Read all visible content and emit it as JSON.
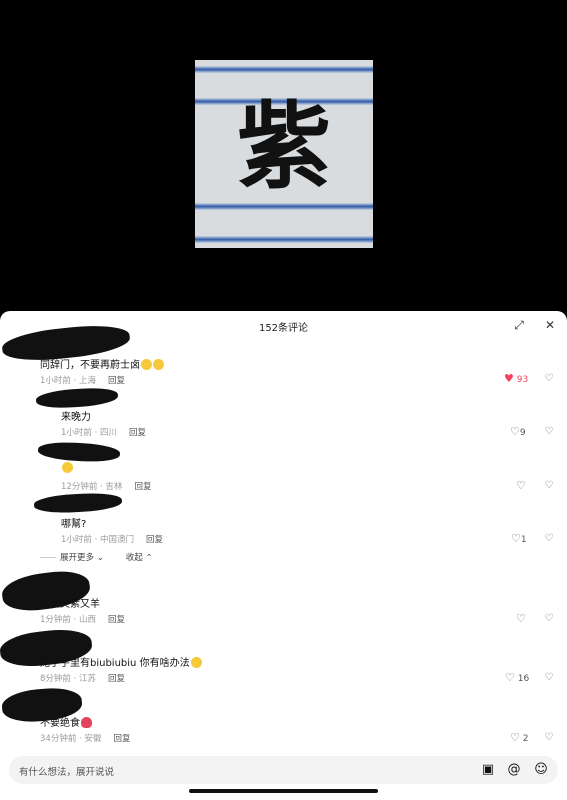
{
  "video": {
    "character": "紫"
  },
  "sheet": {
    "title": "152条评论",
    "expand_icon": "expand-icon",
    "close_icon": "close-icon"
  },
  "comments": [
    {
      "text": "同辞门，不要再蔚士卤",
      "emoji_count": 2,
      "time": "1小时前 · 上海",
      "reply": "回复",
      "likes": "93",
      "liked": true
    },
    {
      "text": "来晚力",
      "time": "1小时前 · 四川",
      "reply": "回复",
      "likes": "9"
    },
    {
      "text": "",
      "emoji_count": 1,
      "time": "12分钟前 · 吉林",
      "reply": "回复",
      "likes": ""
    },
    {
      "text": "哪幫?",
      "time": "1小时前 · 中国澳门",
      "reply": "回复",
      "likes": "1"
    },
    {
      "text": "又赵又紫又羊",
      "time": "1分钟前 · 山西",
      "reply": "回复",
      "likes": ""
    },
    {
      "text": "姥子手里有biubiubiu 你有啥办法",
      "emoji_count": 1,
      "time": "8分钟前 · 江苏",
      "reply": "回复",
      "likes": "16"
    },
    {
      "text": "不要绝食",
      "emoji_count": 1,
      "time": "34分钟前 · 安徽",
      "reply": "回复",
      "likes": "2"
    }
  ],
  "thread": {
    "expand_more": "展开更多",
    "collapse": "收起"
  },
  "input": {
    "placeholder": "有什么想法，展开说说",
    "icons": [
      "image-icon",
      "at-icon",
      "emoji-icon"
    ]
  },
  "colors": {
    "like_active": "#f43f5e",
    "band_blue": "#2d5aa5"
  }
}
